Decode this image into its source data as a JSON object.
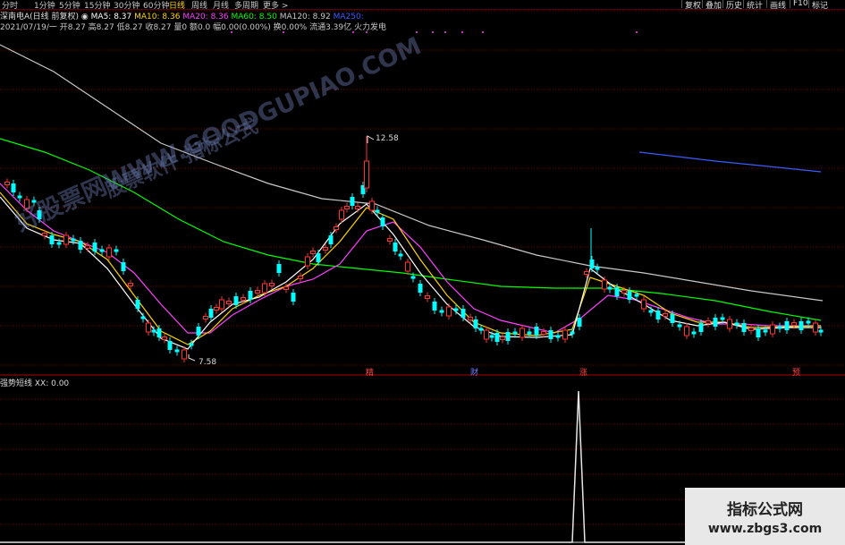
{
  "toolbar": {
    "periods": [
      "分时",
      "1分钟",
      "5分钟",
      "15分钟",
      "30分钟",
      "60分钟",
      "日线",
      "周线",
      "月线",
      "多周期",
      "更多 >"
    ],
    "active_period": "日线",
    "right_buttons": [
      "复权",
      "叠加",
      "历史",
      "统计",
      "画线",
      "F10",
      "标记"
    ]
  },
  "header": {
    "stock": "深南电A(日线 前复权)",
    "ma": [
      {
        "label": "MA5: 8.37",
        "color": "#ffffff"
      },
      {
        "label": "MA10: 8.36",
        "color": "#ffd400"
      },
      {
        "label": "MA20: 8.36",
        "color": "#ff40ff"
      },
      {
        "label": "MA60: 8.50",
        "color": "#00ff00"
      },
      {
        "label": "MA120: 8.92",
        "color": "#c8c8c8"
      },
      {
        "label": "MA250:",
        "color": "#3a5cff"
      }
    ],
    "date_line": "2021/07/19/一 开8.27 高8.27 低8.27 收8.27 量0 额0.0 幅0.00(0.00%) 换0.00% 流通3.39亿 火力发电"
  },
  "annotations": {
    "high": "12.58",
    "low": "7.58"
  },
  "tags": [
    {
      "text": "精",
      "color": "#ff4040"
    },
    {
      "text": "财",
      "color": "#6a7cff"
    },
    {
      "text": "涨",
      "color": "#ff4040"
    },
    {
      "text": "预",
      "color": "#ff4040"
    }
  ],
  "indicator": {
    "title": "强势短线",
    "value": "XX: 0.00"
  },
  "watermark": {
    "line1": "好股票网WWW.GOODGUPIAO.COM",
    "line2": "股票软件 指标公式"
  },
  "brand": {
    "title": "指标公式网",
    "url": "www.zbgs3.com"
  },
  "colors": {
    "up": "#ff3030",
    "down": "#00ffff",
    "ma5": "#ffffff",
    "ma10": "#ffd400",
    "ma20": "#ff40ff",
    "ma60": "#00ff00",
    "ma120": "#c8c8c8",
    "ma250": "#3a5cff",
    "grid": "#7a0000"
  }
}
